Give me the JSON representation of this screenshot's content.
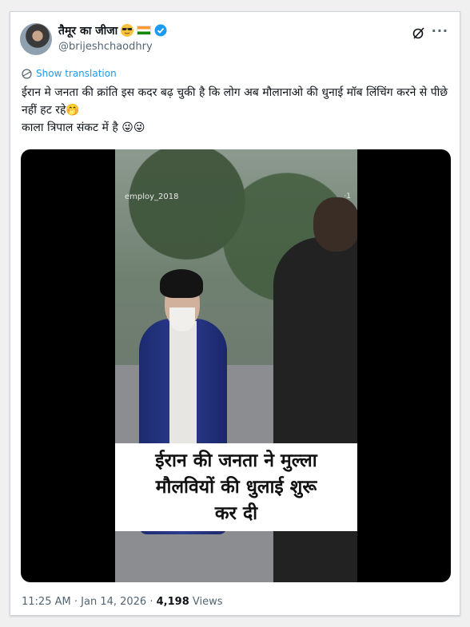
{
  "tweet": {
    "display_name": "तैमूर का जीजा",
    "handle": "@brijeshchaodhry",
    "show_translation": "Show translation",
    "text": "ईरान मे जनता की क्रांति इस कदर बढ़ चुकी है कि लोग अब  मौलानाओ की धुनाई मॉब लिंचिंग करने से पीछे नहीं हट रहे🤭\nकाला त्रिपाल संकट में है 😜😜",
    "time": "11:25 AM",
    "date": "Jan 14, 2026",
    "views_count": "4,198",
    "views_label": "Views",
    "more_label": "···"
  },
  "media": {
    "watermark": "employ_2018",
    "badge": "·1",
    "caption": "ईरान की जनता ने मुल्ला\nमौलवियों की धुलाई शुरू\nकर दी"
  },
  "icons": {
    "emoji": "sunglasses-emoji-icon",
    "flag": "india-flag-icon",
    "verified": "verified-badge-icon",
    "grok": "grok-icon",
    "translate": "globe-icon"
  },
  "colors": {
    "accent": "#1d9bf0",
    "text": "#0f1419",
    "secondary": "#536471"
  }
}
